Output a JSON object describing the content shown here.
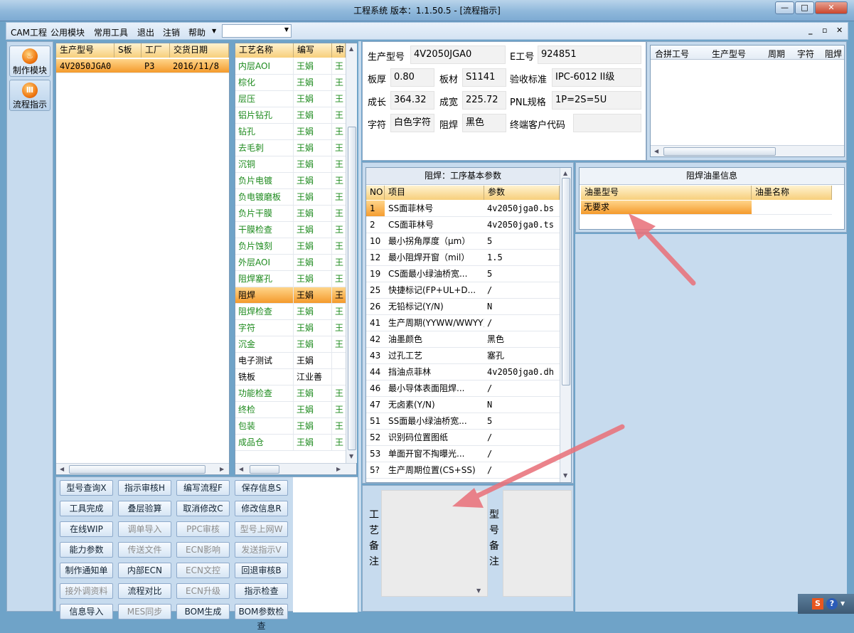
{
  "window": {
    "title": "工程系统   版本：1.1.50.5 - [流程指示]",
    "minimize": "—",
    "maximize": "□",
    "close": "✕"
  },
  "menu": {
    "items": [
      "CAM工程",
      "公用模块",
      "常用工具",
      "退出",
      "注销",
      "帮助"
    ],
    "combo_value": "",
    "mdi": [
      "_",
      "▫",
      "✕"
    ]
  },
  "nav": {
    "buttons": [
      {
        "label": "制作模块"
      },
      {
        "label": "流程指示"
      }
    ]
  },
  "orders": {
    "columns": [
      "生产型号",
      "S板",
      "工厂",
      "交货日期"
    ],
    "rows": [
      {
        "model": "4V2050JGA0",
        "s": "",
        "factory": "P3",
        "date": "2016/11/8"
      }
    ]
  },
  "process": {
    "columns": [
      "工艺名称",
      "编写",
      "审"
    ],
    "rows": [
      {
        "name": "内层AOI",
        "writer": "王娟",
        "rev": "王",
        "color": "green"
      },
      {
        "name": "棕化",
        "writer": "王娟",
        "rev": "王",
        "color": "green"
      },
      {
        "name": "层压",
        "writer": "王娟",
        "rev": "王",
        "color": "green"
      },
      {
        "name": "铝片钻孔",
        "writer": "王娟",
        "rev": "王",
        "color": "green"
      },
      {
        "name": "钻孔",
        "writer": "王娟",
        "rev": "王",
        "color": "green"
      },
      {
        "name": "去毛刺",
        "writer": "王娟",
        "rev": "王",
        "color": "green"
      },
      {
        "name": "沉铜",
        "writer": "王娟",
        "rev": "王",
        "color": "green"
      },
      {
        "name": "负片电镀",
        "writer": "王娟",
        "rev": "王",
        "color": "green"
      },
      {
        "name": "负电镀磨板",
        "writer": "王娟",
        "rev": "王",
        "color": "green"
      },
      {
        "name": "负片干膜",
        "writer": "王娟",
        "rev": "王",
        "color": "green"
      },
      {
        "name": "干膜检查",
        "writer": "王娟",
        "rev": "王",
        "color": "green"
      },
      {
        "name": "负片蚀刻",
        "writer": "王娟",
        "rev": "王",
        "color": "green"
      },
      {
        "name": "外层AOI",
        "writer": "王娟",
        "rev": "王",
        "color": "green"
      },
      {
        "name": "阻焊塞孔",
        "writer": "王娟",
        "rev": "王",
        "color": "green"
      },
      {
        "name": "阻焊",
        "writer": "王娟",
        "rev": "王",
        "color": "selected"
      },
      {
        "name": "阻焊检查",
        "writer": "王娟",
        "rev": "王",
        "color": "green"
      },
      {
        "name": "字符",
        "writer": "王娟",
        "rev": "王",
        "color": "green"
      },
      {
        "name": "沉金",
        "writer": "王娟",
        "rev": "王",
        "color": "green"
      },
      {
        "name": "电子测试",
        "writer": "王娟",
        "rev": "",
        "color": "black"
      },
      {
        "name": "铣板",
        "writer": "江业善",
        "rev": "",
        "color": "black"
      },
      {
        "name": "功能检查",
        "writer": "王娟",
        "rev": "王",
        "color": "green"
      },
      {
        "name": "终检",
        "writer": "王娟",
        "rev": "王",
        "color": "green"
      },
      {
        "name": "包装",
        "writer": "王娟",
        "rev": "王",
        "color": "green"
      },
      {
        "name": "成品仓",
        "writer": "王娟",
        "rev": "王",
        "color": "green"
      }
    ]
  },
  "info": {
    "model_label": "生产型号",
    "model": "4V2050JGA0",
    "e_label": "E工号",
    "e": "924851",
    "thick_label": "板厚",
    "thick": "0.80",
    "material_label": "板材",
    "material": "S1141",
    "std_label": "验收标准",
    "std": "IPC-6012 II级",
    "len_label": "成长",
    "len": "364.32",
    "wid_label": "成宽",
    "wid": "225.72",
    "pnl_label": "PNL规格",
    "pnl": "1P=2S=5U",
    "char_label": "字符",
    "char": "白色字符",
    "mask_label": "阻焊",
    "mask": "黑色",
    "cust_label": "终端客户代码",
    "cust": ""
  },
  "combine": {
    "columns": [
      "合拼工号",
      "生产型号",
      "周期",
      "字符",
      "阻焊"
    ]
  },
  "params": {
    "title": "阻焊：工序基本参数",
    "columns": [
      "NO",
      "项目",
      "参数"
    ],
    "rows": [
      {
        "no": "1",
        "item": "SS面菲林号",
        "value": "4v2050jga0.bs"
      },
      {
        "no": "2",
        "item": "CS面菲林号",
        "value": "4v2050jga0.ts"
      },
      {
        "no": "10",
        "item": "最小拐角厚度（μm）",
        "value": "5"
      },
      {
        "no": "12",
        "item": "最小阻焊开窗（mil）",
        "value": "1.5"
      },
      {
        "no": "19",
        "item": "CS面最小绿油桥宽...",
        "value": "5"
      },
      {
        "no": "25",
        "item": "快捷标记(FP+UL+D...",
        "value": "/"
      },
      {
        "no": "26",
        "item": "无铅标记(Y/N)",
        "value": "N"
      },
      {
        "no": "41",
        "item": "生产周期(YYWW/WWYY)",
        "value": "/"
      },
      {
        "no": "42",
        "item": "油墨颜色",
        "value": "黑色"
      },
      {
        "no": "43",
        "item": "过孔工艺",
        "value": "塞孔"
      },
      {
        "no": "44",
        "item": "挡油点菲林",
        "value": "4v2050jga0.dh"
      },
      {
        "no": "46",
        "item": "最小导体表面阻焊...",
        "value": "/"
      },
      {
        "no": "47",
        "item": "无卤素(Y/N)",
        "value": "N"
      },
      {
        "no": "51",
        "item": "SS面最小绿油桥宽...",
        "value": "5"
      },
      {
        "no": "52",
        "item": "识别码位置图纸",
        "value": "/"
      },
      {
        "no": "53",
        "item": "单面开窗不掏曝光...",
        "value": "/"
      },
      {
        "no": "5?",
        "item": "生产周期位置(CS+SS)",
        "value": "/"
      }
    ]
  },
  "ink": {
    "title": "阻焊油墨信息",
    "columns": [
      "油墨型号",
      "油墨名称"
    ],
    "rows": [
      {
        "type": "无要求",
        "name": ""
      }
    ]
  },
  "notes": {
    "process_label": "工艺备注",
    "model_label": "型号备注"
  },
  "buttons": [
    {
      "label": "型号查询X",
      "enabled": true
    },
    {
      "label": "指示审核H",
      "enabled": true
    },
    {
      "label": "编写流程F",
      "enabled": true
    },
    {
      "label": "保存信息S",
      "enabled": true
    },
    {
      "label": "工具完成",
      "enabled": true
    },
    {
      "label": "叠层验算",
      "enabled": true
    },
    {
      "label": "取消修改C",
      "enabled": true
    },
    {
      "label": "修改信息R",
      "enabled": true
    },
    {
      "label": "在线WIP",
      "enabled": true
    },
    {
      "label": "调单导入",
      "enabled": false
    },
    {
      "label": "PPC审核",
      "enabled": false
    },
    {
      "label": "型号上网W",
      "enabled": false
    },
    {
      "label": "能力参数",
      "enabled": true
    },
    {
      "label": "传送文件",
      "enabled": false
    },
    {
      "label": "ECN影响",
      "enabled": false
    },
    {
      "label": "发送指示V",
      "enabled": false
    },
    {
      "label": "制作通知单",
      "enabled": true
    },
    {
      "label": "内部ECN",
      "enabled": true
    },
    {
      "label": "ECN文控",
      "enabled": false
    },
    {
      "label": "回退审核B",
      "enabled": true
    },
    {
      "label": "接外调资料",
      "enabled": false
    },
    {
      "label": "流程对比",
      "enabled": true
    },
    {
      "label": "ECN升级",
      "enabled": false
    },
    {
      "label": "指示检查",
      "enabled": true
    },
    {
      "label": "信息导入",
      "enabled": true
    },
    {
      "label": "MES同步",
      "enabled": false
    },
    {
      "label": "BOM生成",
      "enabled": true
    },
    {
      "label": "BOM参数检查",
      "enabled": true
    }
  ],
  "tray": {
    "icons": [
      "S",
      "?"
    ]
  }
}
